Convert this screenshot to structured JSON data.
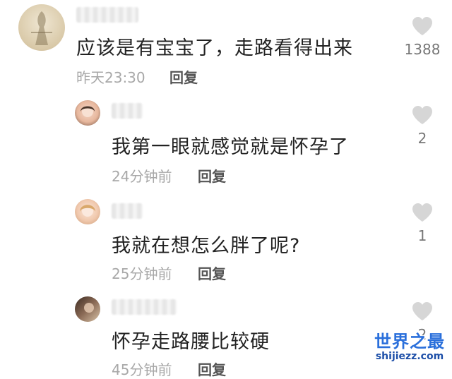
{
  "comments": [
    {
      "text": "应该是有宝宝了，走路看得出来",
      "time": "昨天23:30",
      "reply_label": "回复",
      "likes": "1388",
      "avatar_icon": "avatar-sketch-icon"
    },
    {
      "text": "我第一眼就感觉就是怀孕了",
      "time": "24分钟前",
      "reply_label": "回复",
      "likes": "2",
      "avatar_icon": "avatar-girl-icon"
    },
    {
      "text": "我就在想怎么胖了呢?",
      "time": "25分钟前",
      "reply_label": "回复",
      "likes": "1",
      "avatar_icon": "avatar-girl-icon"
    },
    {
      "text": "怀孕走路腰比较硬",
      "time": "45分钟前",
      "reply_label": "回复",
      "likes": "2",
      "avatar_icon": "avatar-photo-icon"
    }
  ],
  "watermark": {
    "title": "世界之最",
    "domain": "shijiezz.com"
  },
  "colors": {
    "heart": "#d6d6d6",
    "meta": "#a8a8a8",
    "watermark": "#2a6fdb"
  }
}
